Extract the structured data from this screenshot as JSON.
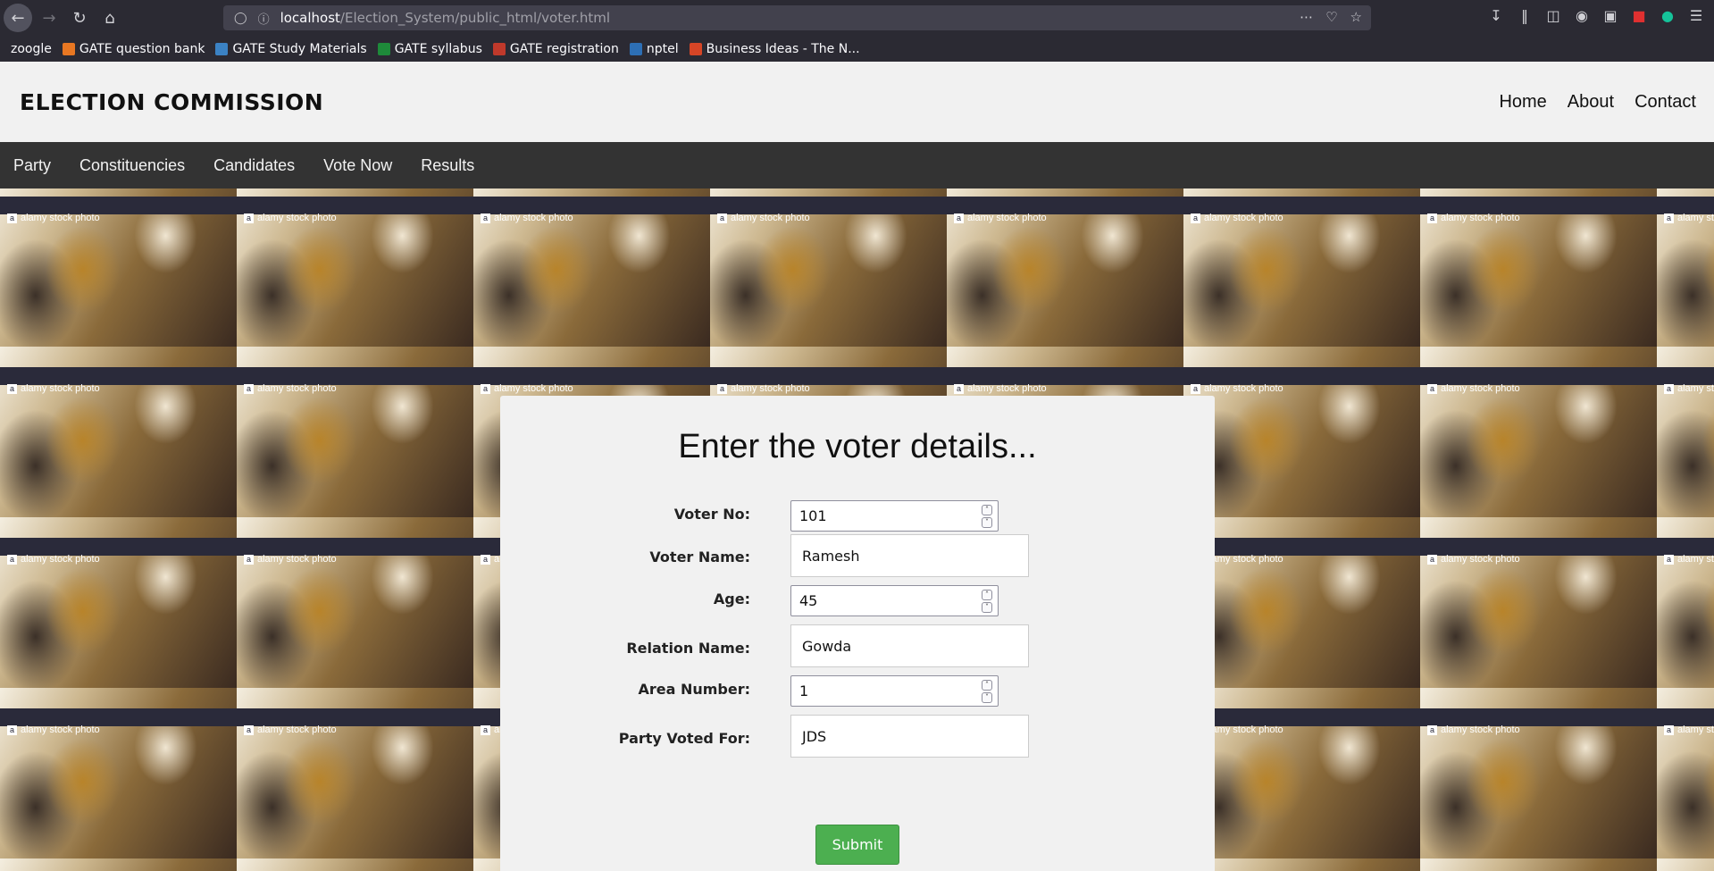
{
  "browser": {
    "url_host": "localhost",
    "url_path": "/Election_System/public_html/voter.html",
    "bookmarks": [
      {
        "label": "zoogle",
        "color": ""
      },
      {
        "label": "GATE question bank",
        "color": "#e87722"
      },
      {
        "label": "GATE Study Materials",
        "color": "#3b82c4"
      },
      {
        "label": "GATE syllabus",
        "color": "#1e8a3a"
      },
      {
        "label": "GATE registration",
        "color": "#c0392b"
      },
      {
        "label": "nptel",
        "color": "#2d6fb5"
      },
      {
        "label": "Business Ideas - The N...",
        "color": "#d64526"
      }
    ]
  },
  "header": {
    "brand": "ELECTION COMMISSION",
    "links": [
      "Home",
      "About",
      "Contact"
    ]
  },
  "nav": {
    "items": [
      "Party",
      "Constituencies",
      "Candidates",
      "Vote Now",
      "Results"
    ]
  },
  "background": {
    "watermark": "alamy stock photo"
  },
  "form": {
    "title": "Enter the voter details...",
    "fields": [
      {
        "label": "Voter No:",
        "value": "101",
        "type": "number"
      },
      {
        "label": "Voter Name:",
        "value": "Ramesh",
        "type": "text"
      },
      {
        "label": "Age:",
        "value": "45",
        "type": "number"
      },
      {
        "label": "Relation Name:",
        "value": "Gowda",
        "type": "text"
      },
      {
        "label": "Area Number:",
        "value": "1",
        "type": "number"
      },
      {
        "label": "Party Voted For:",
        "value": "JDS",
        "type": "text"
      }
    ],
    "submit_label": "Submit"
  }
}
